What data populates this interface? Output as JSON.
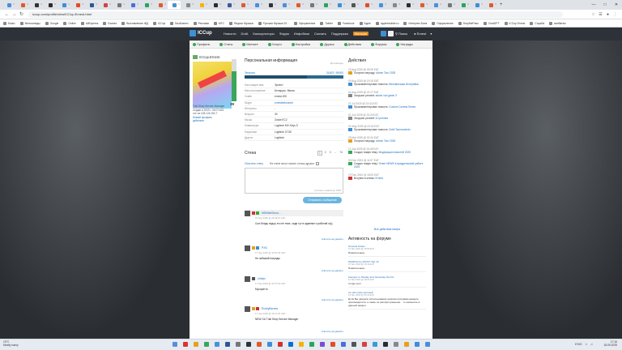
{
  "browser": {
    "url": "iccup.com/profile/view/ICCup.Ernest.html",
    "tab_colors": [
      "#4a90d9",
      "#e05b2b",
      "#333",
      "#2d2d2d",
      "#3d8fd6",
      "#e34c26",
      "#2b5797",
      "#d84040",
      "#777",
      "#4a6ee0",
      "#2aa55a",
      "#e05b2b",
      "#4a90d9",
      "#888",
      "#f4b400",
      "#2d2d2d",
      "#3b5998",
      "#e05b2b",
      "#4a90d9",
      "#333",
      "#4a90d9",
      "#e05b2b",
      "#777",
      "#2aa55a",
      "#3d8fd6",
      "#555",
      "#e34c26",
      "#4a90d9",
      "#888",
      "#2d2d2d",
      "#e05b2b",
      "#4a90d9",
      "#777",
      "#2aa55a",
      "#3d8fd6",
      "#e05b2b"
    ],
    "active_tab_index": 12,
    "bookmarks": [
      "Music",
      "Велосипеды",
      "Google",
      "Online",
      "AliExpress",
      "Бизнес",
      "Выставление ЖД",
      "ICCup",
      "БизБизнес",
      "Реклама",
      "МТС",
      "Яндекс Музыка",
      "Русская Музыка 20...",
      "Оформление",
      "Twitter",
      "Facebook",
      "Apple",
      "appletmobile.ru",
      "Интернет-Банк",
      "Оформление",
      "DropMePass",
      "ChatGPT",
      "ICCup Ernest",
      "Служба",
      "ванбатюк"
    ]
  },
  "site": {
    "logo": "ICCup",
    "nav": [
      "Новости",
      "DotA",
      "Калькуляторы",
      "Форум",
      "Инфобаза",
      "Скачать",
      "Поддержка"
    ],
    "nav_highlight": "Магазин",
    "search": "Поиск",
    "user": "Ernest"
  },
  "subnav": [
    {
      "label": "Профиль",
      "current": true
    },
    {
      "label": "Статы",
      "current": false
    },
    {
      "label": "Матчинг",
      "current": false
    },
    {
      "label": "Услуги",
      "current": false
    },
    {
      "label": "Настройки",
      "current": false
    },
    {
      "label": "Друзья",
      "current": false
    },
    {
      "label": "Действия",
      "current": false
    },
    {
      "label": "Форумы",
      "current": false
    },
    {
      "label": "Награды",
      "current": false
    }
  ],
  "profile": {
    "name": "ICCup.Ernest",
    "level": 39,
    "level_fill": 0.72,
    "role": "Trial Shop Service Manager",
    "info_lines": [
      "создан в 2009 г. 08:07:823",
      "лог из 128.124.254.7",
      "Новый профиль"
    ],
    "actions_link": "действия"
  },
  "personal": {
    "title": "Персональная информация",
    "right_tag": "фото/видео",
    "xp_label": "Энергия",
    "xp_value": "31403 / 50000",
    "xp_fill": 0.63,
    "rows": [
      {
        "k": "Настоящее имя",
        "v": "Эрнест",
        "link": false
      },
      {
        "k": "Местоположение",
        "v": "Беларусь, Минск",
        "link": false
      },
      {
        "k": "Скайп",
        "v": "ernest.200",
        "link": false
      },
      {
        "k": "Skype",
        "v": "ernestbelmontel",
        "link": true
      },
      {
        "k": "Интересы",
        "v": "-",
        "link": false
      },
      {
        "k": "Возраст",
        "v": "30",
        "link": false
      },
      {
        "k": "Мышь",
        "v": "Zowie EC2",
        "link": false
      },
      {
        "k": "Клавиатура",
        "v": "Logitech MX Keys S",
        "link": false
      },
      {
        "k": "Наушники",
        "v": "Logitech G735",
        "link": false
      },
      {
        "k": "Другое",
        "v": "Logitech",
        "link": false
      }
    ]
  },
  "wall": {
    "title": "Стена",
    "pages": [
      "1",
      "2",
      "3",
      "...",
      "74"
    ],
    "clear_label": "Очистить стену",
    "only_friends": "На стене могут писать только друзья",
    "counter": "осталось символов: 1000",
    "send_label": "Отправить сообщение",
    "posts": [
      {
        "user": "MShNetSexul...",
        "date": "15 Sep 2025 @ 20:49:27 CET",
        "text": "Сын блядь пидор это не твое, сиди тут в админке и работай ок))",
        "reply": "ответить на",
        "del": "удалить",
        "hl": true,
        "tags": [
          "#c33",
          "#3a3"
        ]
      },
      {
        "user": "PXD",
        "date": "17 Sep 2025 @ 10:51:33 CET",
        "text": "Не забывай награды",
        "reply": "ответить на",
        "del": "удалить",
        "hl": false,
        "tags": [
          "#e8a020",
          "#3d8fd6"
        ]
      },
      {
        "user": "z0ofyx",
        "date": "17 Sep 2025 @ 10:37:18 CET",
        "text": "Мусорятто",
        "reply": "ответить на",
        "del": "удалить",
        "hl": false,
        "tags": [
          "#555"
        ]
      },
      {
        "user": "RockyBarnes",
        "date": "17 Sep 2025 @ 16:21:25 CET",
        "text": "NEW GU Trial Shop Service Manager",
        "reply": "ответить на",
        "del": "удалить",
        "hl": false,
        "tags": [
          "#e8a020",
          "#c33"
        ]
      }
    ]
  },
  "actions": {
    "title": "Действия",
    "items": [
      {
        "date": "15 Aug 2025 @ 09:09 EAT",
        "text": "Получил награду:",
        "link": "Admin Tour 2025",
        "color": "#e8a020"
      },
      {
        "date": "09 Aug 2025 @ 19:15 EAT",
        "text": "Прокомментировал новость:",
        "link": "Вельветкаши Истерийка",
        "color": "#3d8fd6"
      },
      {
        "date": "04 Aug 2025 @ 22:17 EAT",
        "text": "Загрузил реплей:",
        "link": "admin vob game 3",
        "color": "#888"
      },
      {
        "date": "22 Jul 2025 @ 23:42 EAT",
        "text": "Прокомментировал новость:",
        "link": "Custom Contest Series",
        "color": "#3d8fd6"
      },
      {
        "date": "01 Jun 2025 @ 15:29 EAT",
        "text": "Загрузил реплей:",
        "link": "DJ рeплеи",
        "color": "#888"
      },
      {
        "date": "01 May 2025 @ 23:43 EAT",
        "text": "Прокомментировал новость:",
        "link": "DotA Tournaments",
        "color": "#3d8fd6"
      },
      {
        "date": "29 Mar 2025 @ 02:34 EAT",
        "text": "Получил награду:",
        "link": "Admin Tour 2025",
        "color": "#e8a020"
      },
      {
        "date": "12 Jan 2025 @ 15:49 EAT",
        "text": "Создал новую тему:",
        "link": "Модерация новостей 2025",
        "color": "#3aa65a"
      },
      {
        "date": "30 Dec 2024 @ 11:07 EAT",
        "text": "Создал новую тему:",
        "link": "Ответ NEWS в предрелизной работе 2025",
        "color": "#3aa65a"
      },
      {
        "date": "19 Dec 2024 @ 15:03 EAT",
        "text": "Вступил в кланы:",
        "link": "Ernest",
        "color": "#c33"
      }
    ],
    "all_label": "Все действия юзера"
  },
  "forum": {
    "title": "Активность на форуме",
    "items": [
      {
        "t": "Survival Chaos",
        "d": "13 Nov 2024 @ 15:55 EAT",
        "x": "Невнятненько."
      },
      {
        "t": "Wellbirds by WCCO Top 10",
        "d": "15 Nov 2024 @ 15:42 EAT",
        "x": "Невнятненько."
      },
      {
        "t": "Конкурс от Replay and Gameday Set DL",
        "d": "14 Nov 2024 @ 18:04 EAT",
        "x": "i.imgur.com"
      },
      {
        "t": "не заступим зеленый",
        "d": "13 Nov 2024 @ 05:10 EAT",
        "x": "Если Вы увидели использование напоказ программ данного производителя, а также их распространение... то напишите в данный раздел."
      }
    ]
  },
  "taskbar": {
    "weather_temp": "19°C",
    "weather_desc": "Mostly sunny",
    "icons": [
      "#5a8ed6",
      "#d33",
      "#e8a020",
      "#3aa65a",
      "#4a90d9",
      "#2b5797",
      "#777",
      "#333",
      "#e05b2b",
      "#3d8fd6",
      "#c33",
      "#0b70d0",
      "#f4b400",
      "#2aa55a",
      "#7b4fd0",
      "#e34c26",
      "#4a6ee0",
      "#555",
      "#d84040",
      "#3a9bd6",
      "#2d2d2d",
      "#888",
      "#e8a020",
      "#3d8fd6",
      "#4a90d9"
    ],
    "time": "17:16",
    "date": "18.09.2025",
    "lang": "ENG"
  }
}
